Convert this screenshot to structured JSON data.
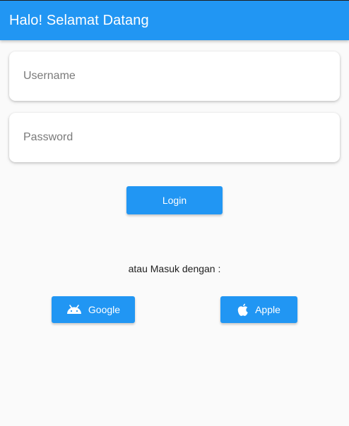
{
  "appbar": {
    "title": "Halo! Selamat Datang",
    "color": "#2196f3"
  },
  "form": {
    "username": {
      "placeholder": "Username",
      "value": ""
    },
    "password": {
      "placeholder": "Password",
      "value": ""
    },
    "login_label": "Login"
  },
  "alternative": {
    "text": "atau Masuk dengan :",
    "google": {
      "label": "Google",
      "icon": "android-icon"
    },
    "apple": {
      "label": "Apple",
      "icon": "apple-icon"
    }
  },
  "colors": {
    "primary": "#2196f3",
    "background": "#fafafa",
    "card": "#ffffff"
  }
}
